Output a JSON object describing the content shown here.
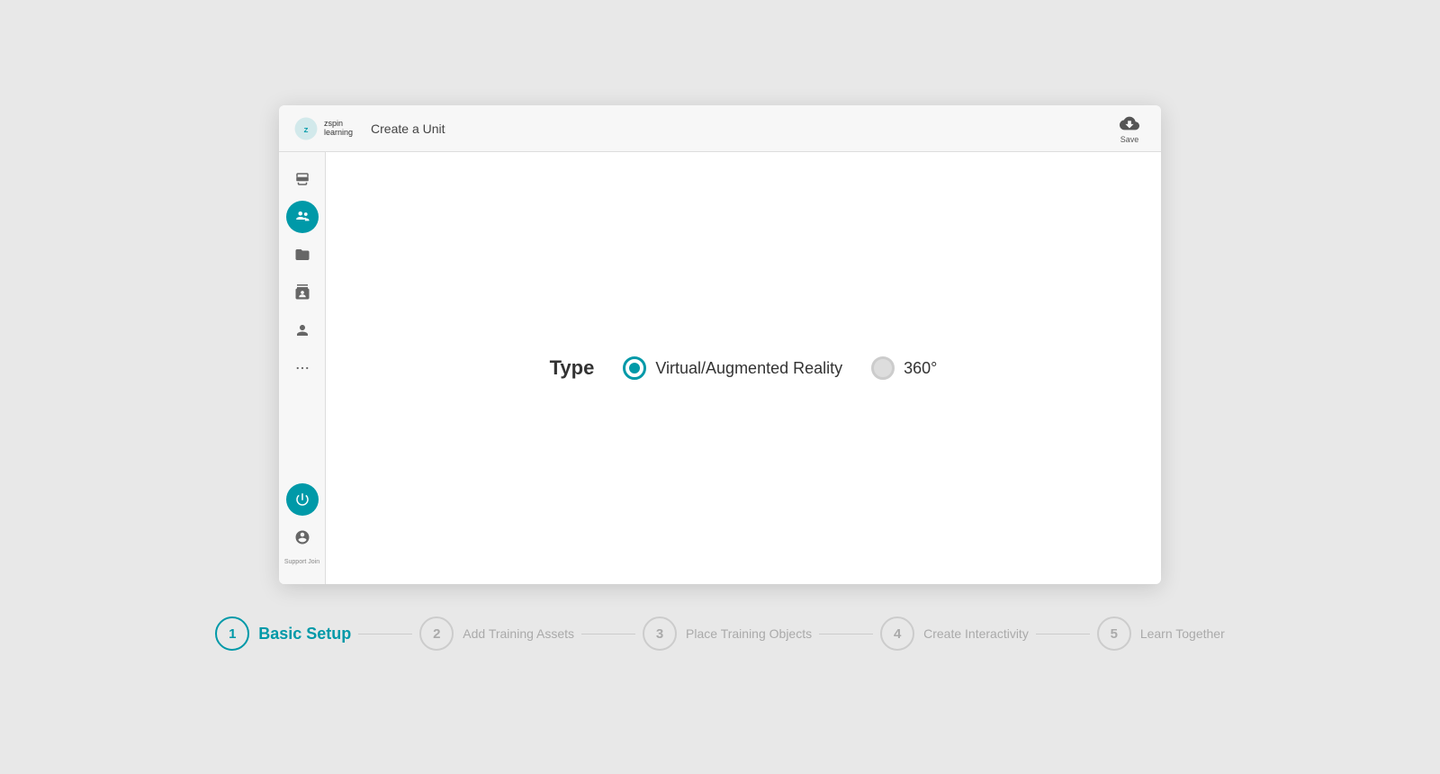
{
  "app": {
    "logo_line1": "zspin",
    "logo_line2": "learning",
    "header_title": "Create a Unit",
    "save_label": "Save"
  },
  "sidebar": {
    "items": [
      {
        "name": "layers-icon",
        "icon": "layers",
        "active": false
      },
      {
        "name": "users-icon",
        "icon": "users",
        "active": true
      },
      {
        "name": "folder-icon",
        "icon": "folder",
        "active": false
      },
      {
        "name": "contacts-icon",
        "icon": "contacts",
        "active": false
      },
      {
        "name": "person-icon",
        "icon": "person",
        "active": false
      },
      {
        "name": "more-icon",
        "icon": "more",
        "active": false
      }
    ],
    "bottom_items": [
      {
        "name": "power-icon",
        "icon": "power",
        "active": true
      },
      {
        "name": "account-icon",
        "icon": "account",
        "active": false
      }
    ],
    "support_label": "Support\nJoin"
  },
  "content": {
    "type_label": "Type",
    "option1_label": "Virtual/Augmented Reality",
    "option1_selected": true,
    "option2_label": "360°",
    "option2_selected": false
  },
  "wizard": {
    "steps": [
      {
        "number": "1",
        "label": "Basic Setup",
        "active": true
      },
      {
        "number": "2",
        "label": "Add Training Assets",
        "active": false
      },
      {
        "number": "3",
        "label": "Place Training Objects",
        "active": false
      },
      {
        "number": "4",
        "label": "Create Interactivity",
        "active": false
      },
      {
        "number": "5",
        "label": "Learn Together",
        "active": false
      }
    ]
  },
  "colors": {
    "accent": "#0099a8",
    "inactive": "#aaaaaa",
    "text_dark": "#333333"
  }
}
